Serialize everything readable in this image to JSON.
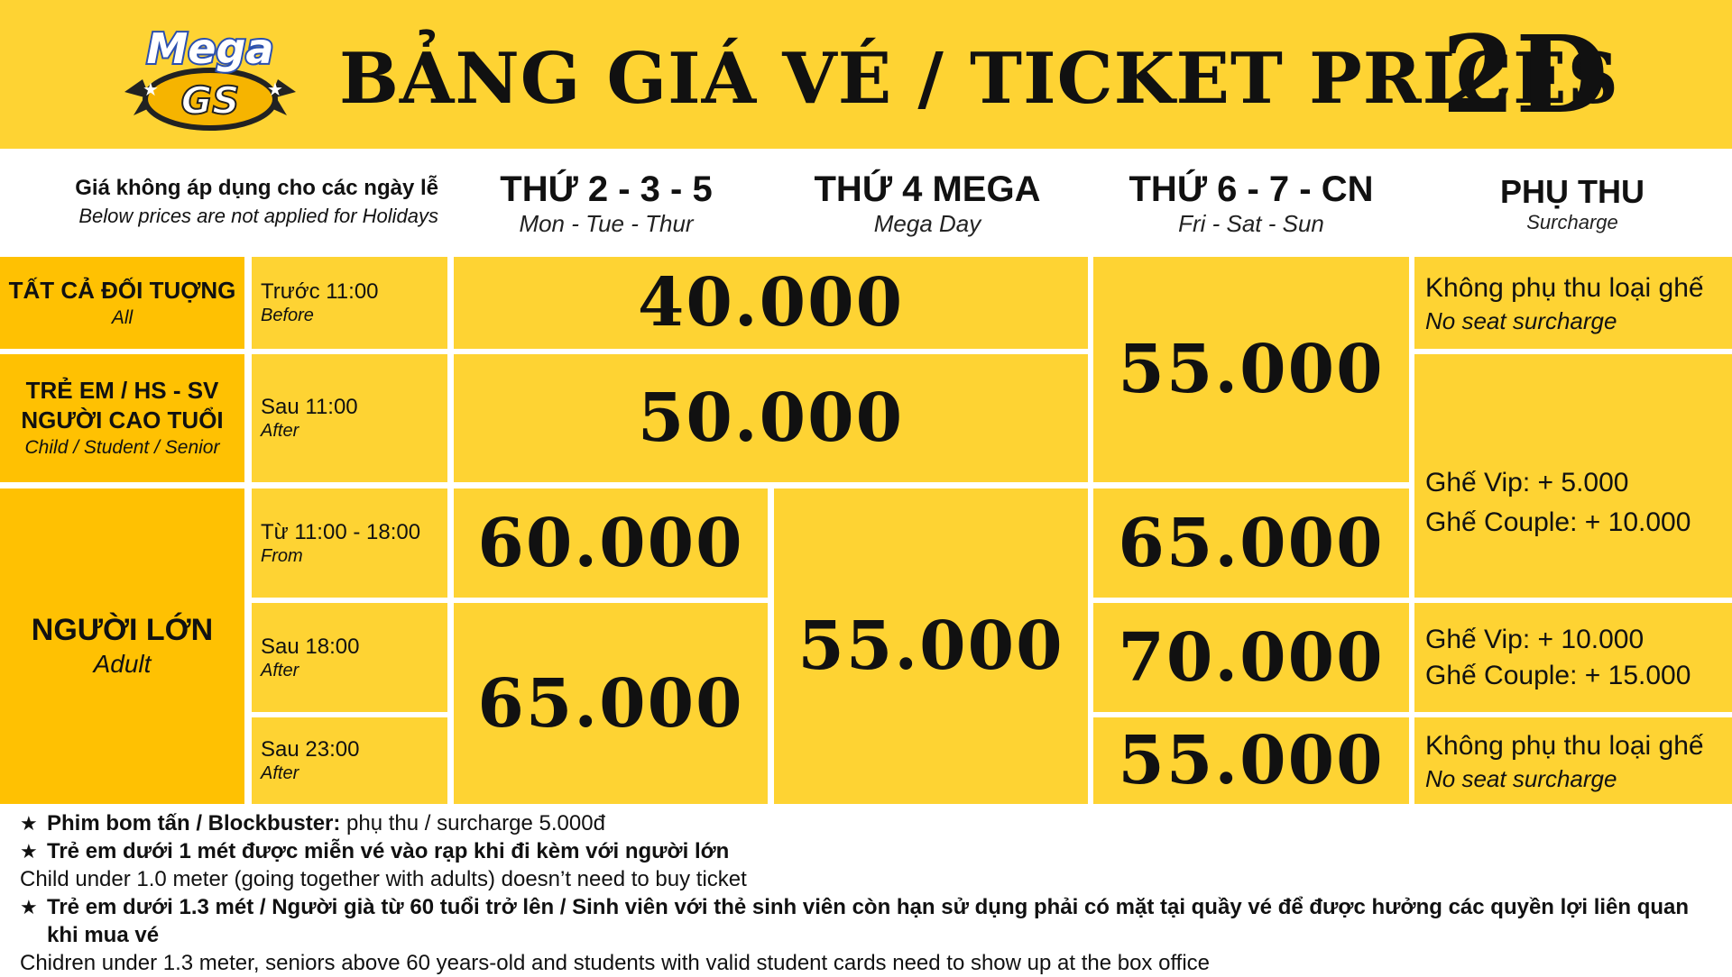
{
  "header": {
    "logo_top": "Mega",
    "logo_bottom": "GS",
    "title": "BẢNG GIÁ VÉ / TICKET PRICES",
    "format": "2D"
  },
  "holiday_note": {
    "vi": "Giá không áp dụng cho các ngày lễ",
    "en": "Below prices are not applied for Holidays"
  },
  "columns": [
    {
      "vi": "THỨ 2 - 3 - 5",
      "en": "Mon - Tue - Thur"
    },
    {
      "vi": "THỨ 4 MEGA",
      "en": "Mega Day"
    },
    {
      "vi": "THỨ 6 - 7 - CN",
      "en": "Fri - Sat - Sun"
    },
    {
      "vi": "PHỤ THU",
      "en": "Surcharge"
    }
  ],
  "rows": {
    "all": {
      "vi": "TẤT CẢ ĐỐI TUỢNG",
      "en": "All"
    },
    "child": {
      "vi1": "TRẺ EM / HS - SV",
      "vi2": "NGƯỜI CAO TUỔI",
      "en": "Child / Student / Senior"
    },
    "adult": {
      "vi": "NGƯỜI LỚN",
      "en": "Adult"
    }
  },
  "times": [
    {
      "vi": "Trước 11:00",
      "en": "Before"
    },
    {
      "vi": "Sau 11:00",
      "en": "After"
    },
    {
      "vi": "Từ 11:00 - 18:00",
      "en": "From"
    },
    {
      "vi": "Sau 18:00",
      "en": "After"
    },
    {
      "vi": "Sau 23:00",
      "en": "After"
    }
  ],
  "prices": {
    "before11_mon_wed": "40.000",
    "after11_mon_wed": "50.000",
    "child_fri_sun": "55.000",
    "adult_day_mon_thu": "60.000",
    "adult_evening_mon_thu": "65.000",
    "adult_wed_mega": "55.000",
    "adult_day_fri_sun": "65.000",
    "adult_after18_fri_sun": "70.000",
    "adult_after23_fri_sun": "55.000"
  },
  "surcharges": {
    "no_surcharge_vi": "Không phụ thu loại ghế",
    "no_surcharge_en": "No seat surcharge",
    "mid_vip": "Ghế Vip: + 5.000",
    "mid_couple": "Ghế Couple: + 10.000",
    "eve_vip": "Ghế Vip: + 10.000",
    "eve_couple": "Ghế Couple: + 15.000"
  },
  "notes": [
    {
      "bold": "Phim bom tấn / Blockbuster:",
      "text": " phụ thu / surcharge 5.000đ"
    },
    {
      "bold": "Trẻ em dưới 1 mét được miễn vé vào rạp khi đi kèm với người lớn",
      "sub": "Child under 1.0 meter (going together with adults) doesn’t need to buy ticket"
    },
    {
      "bold": "Trẻ em dưới 1.3 mét / Người già từ 60 tuổi trở lên /  Sinh viên với thẻ sinh viên còn hạn sử dụng phải có mặt tại quầy vé để được hưởng các quyền lợi liên quan khi mua vé",
      "sub": "Chidren under 1.3 meter, seniors above 60 years-old and students with valid student cards need to show up at the box office"
    }
  ],
  "colors": {
    "yellow": "#fed333",
    "dark_yellow": "#ffc102",
    "logo_blue": "#2a4fb0"
  }
}
